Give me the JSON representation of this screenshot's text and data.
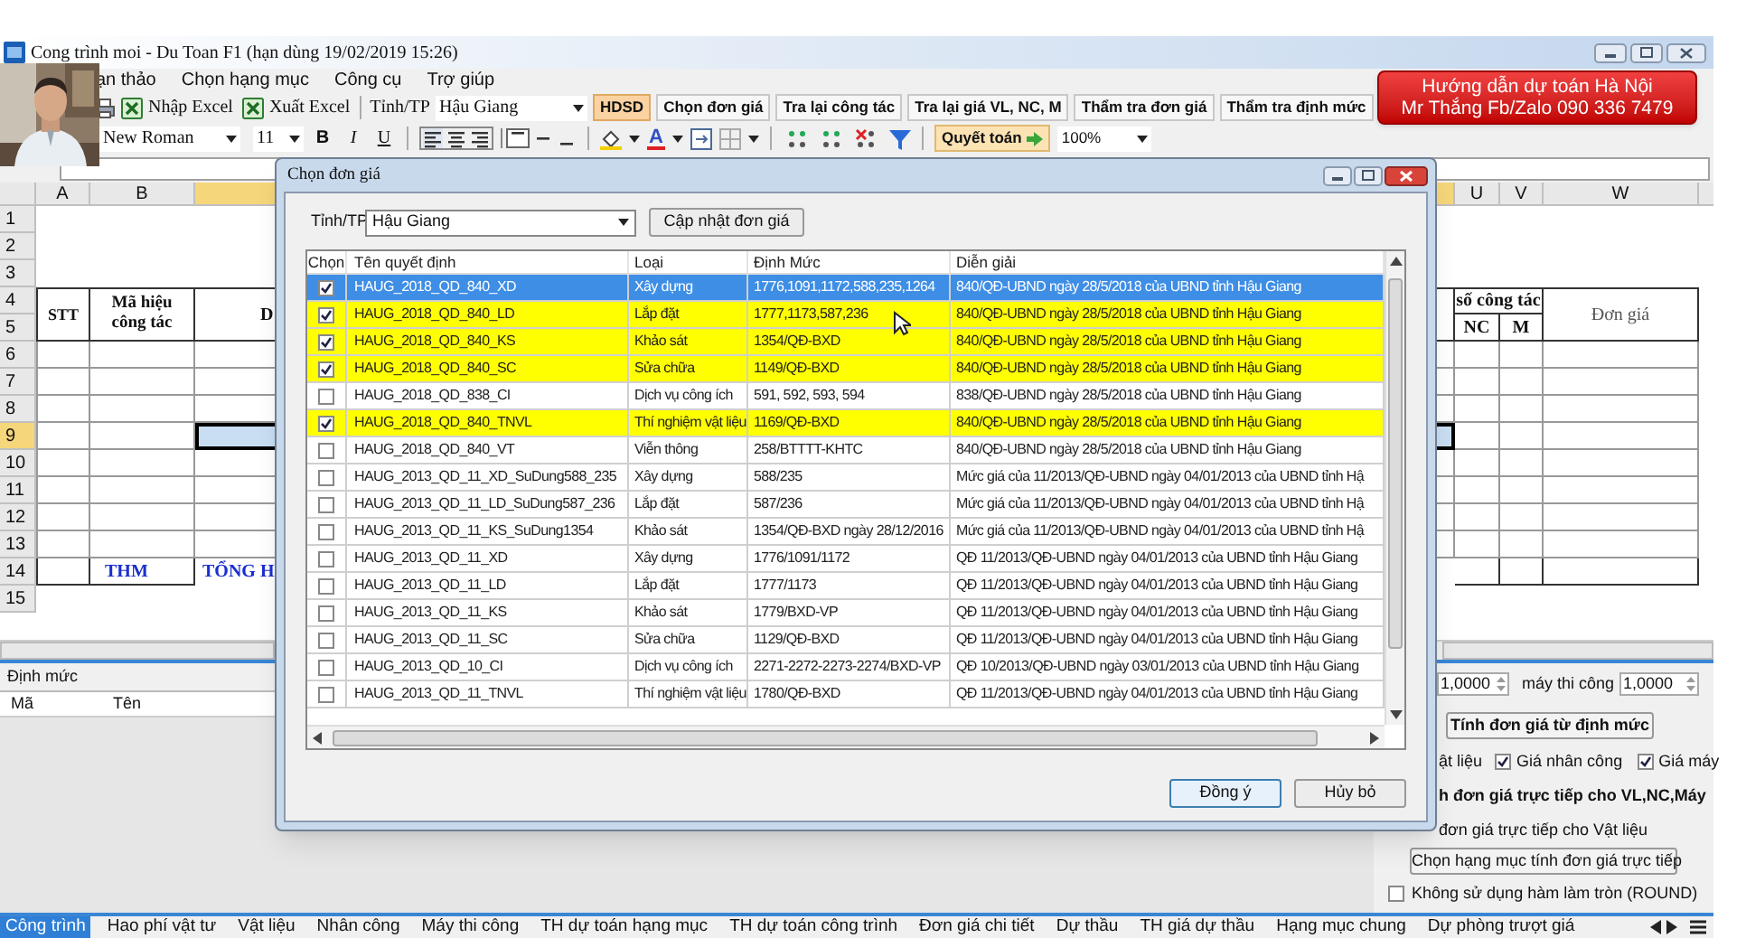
{
  "window": {
    "title": "Cong trình moi - Du Toan F1  (hạn dùng 19/02/2019 15:26)"
  },
  "menu": [
    "ạn thảo",
    "Chọn hạng mục",
    "Công cụ",
    "Trợ giúp"
  ],
  "toolbar": {
    "import_excel": "Nhập Excel",
    "export_excel": "Xuất Excel",
    "province_label": "Tỉnh/TP",
    "province": "Hậu Giang",
    "buttons": [
      {
        "label": "HDSD",
        "highlighted": true
      },
      {
        "label": "Chọn đơn giá",
        "highlighted": false
      },
      {
        "label": "Tra lại công tác",
        "highlighted": false
      },
      {
        "label": "Tra lại giá VL, NC, M",
        "highlighted": false
      },
      {
        "label": "Thẩm tra đơn giá",
        "highlighted": false
      },
      {
        "label": "Thẩm tra định mức",
        "highlighted": false
      }
    ],
    "font": "New Roman",
    "font_size": "11",
    "format_buttons": [
      "B",
      "I",
      "U"
    ],
    "font_color": "A",
    "settlement": "Quyết toán",
    "zoom": "100%"
  },
  "banner": [
    "Hướng dẫn dự toán Hà Nội",
    "Mr Thắng Fb/Zalo 090 336 7479"
  ],
  "sheet": {
    "columns": [
      {
        "label": "A",
        "selected": false
      },
      {
        "label": "B",
        "selected": false
      },
      {
        "selected": true
      },
      {
        "label": "U",
        "selected": false
      },
      {
        "label": "V",
        "selected": false
      },
      {
        "label": "W",
        "selected": false
      }
    ],
    "rows": [
      {
        "label": "1",
        "selected": false
      },
      {
        "label": "2",
        "selected": false
      },
      {
        "label": "3",
        "selected": false
      },
      {
        "label": "4",
        "selected": false
      },
      {
        "label": "5",
        "selected": false
      },
      {
        "label": "6",
        "selected": false
      },
      {
        "label": "7",
        "selected": false
      },
      {
        "label": "8",
        "selected": false
      },
      {
        "label": "9",
        "selected": true
      },
      {
        "label": "10",
        "selected": false
      },
      {
        "label": "11",
        "selected": false
      },
      {
        "label": "12",
        "selected": false
      },
      {
        "label": "13",
        "selected": false
      },
      {
        "label": "14",
        "selected": false
      },
      {
        "label": "15",
        "selected": false
      }
    ],
    "header": {
      "stt": "STT",
      "code": "Mã hiệu công tác",
      "column_c": "D",
      "quantity": "số công tác",
      "labor": "NC",
      "machine": "M",
      "unit_price": "Đơn giá"
    },
    "total_row": {
      "code": "THM",
      "column_c": "TỔNG H"
    }
  },
  "dialog": {
    "title": "Chọn đơn giá",
    "province_label": "Tỉnh/TP",
    "province": "Hậu Giang",
    "update_button": "Cập nhật đơn giá",
    "columns": [
      "Chọn",
      "Tên quyết định",
      "Loại",
      "Định Mức",
      "Diễn giải"
    ],
    "rows": [
      {
        "checked": true,
        "selected": true,
        "name": "HAUG_2018_QD_840_XD",
        "type": "Xây dựng",
        "norm": "1776,1091,1172,588,235,1264",
        "description": "840/QĐ-UBND ngày 28/5/2018 của UBND tỉnh Hậu Giang"
      },
      {
        "checked": true,
        "selected": false,
        "name": "HAUG_2018_QD_840_LD",
        "type": "Lắp đặt",
        "norm": "1777,1173,587,236",
        "description": "840/QĐ-UBND ngày 28/5/2018 của UBND tỉnh Hậu Giang"
      },
      {
        "checked": true,
        "selected": false,
        "name": "HAUG_2018_QD_840_KS",
        "type": "Khảo sát",
        "norm": "1354/QĐ-BXD",
        "description": "840/QĐ-UBND ngày 28/5/2018 của UBND tỉnh Hậu Giang"
      },
      {
        "checked": true,
        "selected": false,
        "name": "HAUG_2018_QD_840_SC",
        "type": "Sửa chữa",
        "norm": "1149/QĐ-BXD",
        "description": "840/QĐ-UBND ngày 28/5/2018 của UBND tỉnh Hậu Giang"
      },
      {
        "checked": false,
        "selected": false,
        "name": "HAUG_2018_QD_838_CI",
        "type": "Dịch vụ công ích",
        "norm": "591, 592, 593, 594",
        "description": "838/QĐ-UBND ngày 28/5/2018 của UBND tỉnh Hậu Giang"
      },
      {
        "checked": true,
        "selected": false,
        "name": "HAUG_2018_QD_840_TNVL",
        "type": "Thí nghiệm vật liệu",
        "norm": "1169/QĐ-BXD",
        "description": "840/QĐ-UBND ngày 28/5/2018 của UBND tỉnh Hậu Giang"
      },
      {
        "checked": false,
        "selected": false,
        "name": "HAUG_2018_QD_840_VT",
        "type": "Viễn thông",
        "norm": "258/BTTTT-KHTC",
        "description": "840/QĐ-UBND ngày 28/5/2018 của UBND tỉnh Hậu Giang"
      },
      {
        "checked": false,
        "selected": false,
        "name": "HAUG_2013_QD_11_XD_SuDung588_235",
        "type": "Xây dựng",
        "norm": "588/235",
        "description": "Mức giá của 11/2013/QĐ-UBND ngày 04/01/2013 của UBND tỉnh Hậ"
      },
      {
        "checked": false,
        "selected": false,
        "name": "HAUG_2013_QD_11_LD_SuDung587_236",
        "type": "Lắp đặt",
        "norm": "587/236",
        "description": "Mức giá của 11/2013/QĐ-UBND ngày 04/01/2013 của UBND tỉnh Hậ"
      },
      {
        "checked": false,
        "selected": false,
        "name": "HAUG_2013_QD_11_KS_SuDung1354",
        "type": "Khảo sát",
        "norm": "1354/QĐ-BXD ngày 28/12/2016",
        "description": "Mức giá của 11/2013/QĐ-UBND ngày 04/01/2013 của UBND tỉnh Hậ"
      },
      {
        "checked": false,
        "selected": false,
        "name": "HAUG_2013_QD_11_XD",
        "type": "Xây dựng",
        "norm": "1776/1091/1172",
        "description": "QĐ 11/2013/QĐ-UBND ngày 04/01/2013 của UBND tỉnh Hậu Giang"
      },
      {
        "checked": false,
        "selected": false,
        "name": "HAUG_2013_QD_11_LD",
        "type": "Lắp đặt",
        "norm": "1777/1173",
        "description": "QĐ 11/2013/QĐ-UBND ngày 04/01/2013 của UBND tỉnh Hậu Giang"
      },
      {
        "checked": false,
        "selected": false,
        "name": "HAUG_2013_QD_11_KS",
        "type": "Khảo sát",
        "norm": "1779/BXD-VP",
        "description": "QĐ 11/2013/QĐ-UBND ngày 04/01/2013 của UBND tỉnh Hậu Giang"
      },
      {
        "checked": false,
        "selected": false,
        "name": "HAUG_2013_QD_11_SC",
        "type": "Sửa chữa",
        "norm": "1129/QĐ-BXD",
        "description": "QĐ 11/2013/QĐ-UBND ngày 04/01/2013 của UBND tỉnh Hậu Giang"
      },
      {
        "checked": false,
        "selected": false,
        "name": "HAUG_2013_QD_10_CI",
        "type": "Dịch vụ công ích",
        "norm": "2271-2272-2273-2274/BXD-VP",
        "description": "QĐ 10/2013/QĐ-UBND ngày 03/01/2013 của UBND tỉnh Hậu Giang"
      },
      {
        "checked": false,
        "selected": false,
        "name": "HAUG_2013_QD_11_TNVL",
        "type": "Thí nghiệm vật liệu",
        "norm": "1780/QĐ-BXD",
        "description": "QĐ 11/2013/QĐ-UBND ngày 04/01/2013 của UBND tỉnh Hậu Giang"
      }
    ],
    "buttons": [
      "Đồng ý",
      "Hủy bỏ"
    ]
  },
  "norm_panel": {
    "title": "Định mức",
    "columns": [
      "Mã",
      "Tên"
    ]
  },
  "price_panel": {
    "factor_1": "1,0000",
    "machine_label": "máy thi công",
    "factor_2": "1,0000",
    "compute_button": "Tính đơn giá từ định mức",
    "material_label": "ật liệu",
    "price_checks": [
      {
        "label": "Giá nhân công",
        "checked": true
      },
      {
        "label": "Giá máy",
        "checked": true
      }
    ],
    "direct_heading": "h đơn giá trực tiếp cho VL,NC,Máy",
    "direct_material": "đơn giá trực tiếp cho Vật liệu",
    "select_button": "Chọn hạng mục tính đơn giá trực tiếp",
    "round_check": {
      "label": "Không sử dụng hàm làm tròn (ROUND)",
      "checked": false
    }
  },
  "tabs": [
    {
      "label": "Công trình",
      "selected": true
    },
    {
      "label": "Hao phí vật tư",
      "selected": false
    },
    {
      "label": "Vật liệu",
      "selected": false
    },
    {
      "label": "Nhân công",
      "selected": false
    },
    {
      "label": "Máy thi công",
      "selected": false
    },
    {
      "label": "TH dự toán hạng mục",
      "selected": false
    },
    {
      "label": "TH dự toán công trình",
      "selected": false
    },
    {
      "label": "Đơn giá chi tiết",
      "selected": false
    },
    {
      "label": "Dự thầu",
      "selected": false
    },
    {
      "label": "TH giá dự thầu",
      "selected": false
    },
    {
      "label": "Hạng mục chung",
      "selected": false
    },
    {
      "label": "Dự phòng trượt giá",
      "selected": false
    }
  ]
}
